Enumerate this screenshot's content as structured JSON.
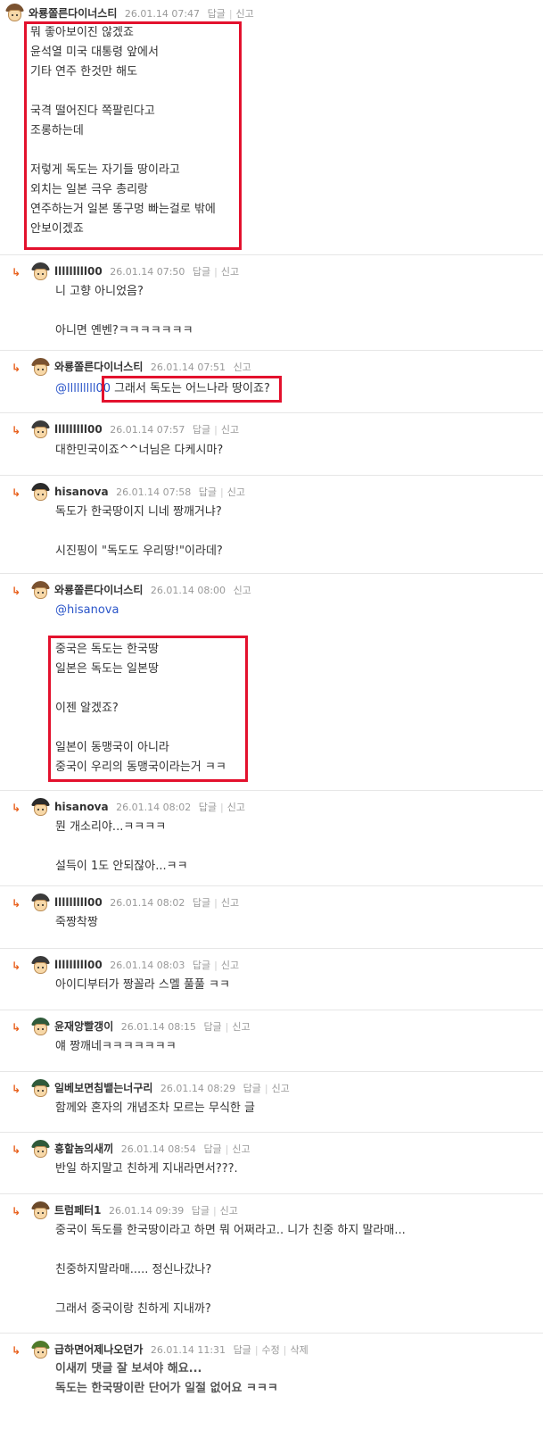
{
  "labels": {
    "reply": "답글",
    "report": "신고",
    "edit": "수정",
    "delete": "삭제",
    "reply_arrow": "↳"
  },
  "comments": [
    {
      "nick": "와룡쫄른다이너스티",
      "date": "26.01.14 07:47",
      "lines": [
        "뭐 좋아보이진 않겠죠",
        "윤석열 미국 대통령 앞에서",
        "기타 연주 한것만 해도",
        "",
        "국격 떨어진다 쪽팔린다고",
        "조롱하는데",
        "",
        "저렇게 독도는 자기들 땅이라고",
        "외치는 일본 극우 총리랑",
        "연주하는거 일본 똥구멍 빠는걸로 밖에",
        "안보이겠죠"
      ]
    },
    {
      "nick": "lllllllll00",
      "date": "26.01.14 07:50",
      "lines": [
        "니 고향 아니었음?",
        "",
        "아니면 옌벤?ㅋㅋㅋㅋㅋㅋㅋ"
      ]
    },
    {
      "nick": "와룡쫄른다이너스티",
      "date": "26.01.14 07:51",
      "mention": "@lllllllll00",
      "lines": [
        "그래서 독도는 어느나라 땅이죠?"
      ]
    },
    {
      "nick": "lllllllll00",
      "date": "26.01.14 07:57",
      "lines": [
        "대한민국이죠^^너님은 다케시마?"
      ]
    },
    {
      "nick": "hisanova",
      "date": "26.01.14 07:58",
      "lines": [
        "독도가 한국땅이지 니네 짱깨거냐?",
        "",
        "시진핑이 \"독도도 우리땅!\"이라데?"
      ]
    },
    {
      "nick": "와룡쫄른다이너스티",
      "date": "26.01.14 08:00",
      "mention": "@hisanova",
      "lines": [
        "중국은 독도는 한국땅",
        "일본은 독도는 일본땅",
        "",
        "이젠 알겠죠?",
        "",
        "일본이 동맹국이 아니라",
        "중국이 우리의 동맹국이라는거 ㅋㅋ"
      ]
    },
    {
      "nick": "hisanova",
      "date": "26.01.14 08:02",
      "lines": [
        "뭔 개소리야...ㅋㅋㅋㅋ",
        "",
        "설득이 1도 안되잖아...ㅋㅋ"
      ]
    },
    {
      "nick": "lllllllll00",
      "date": "26.01.14 08:02",
      "lines": [
        "죽짱착짱"
      ]
    },
    {
      "nick": "lllllllll00",
      "date": "26.01.14 08:03",
      "lines": [
        "아이디부터가 짱꼴라 스멜 풀풀 ㅋㅋ"
      ]
    },
    {
      "nick": "윤재앙빨갱이",
      "date": "26.01.14 08:15",
      "lines": [
        "얘 짱깨네ㅋㅋㅋㅋㅋㅋㅋ"
      ]
    },
    {
      "nick": "일베보면침뱉는너구리",
      "date": "26.01.14 08:29",
      "lines": [
        "함께와 혼자의 개념조차 모르는 무식한 글"
      ]
    },
    {
      "nick": "흥할놈의새끼",
      "date": "26.01.14 08:54",
      "lines": [
        "반일 하지말고 친하게 지내라면서???."
      ]
    },
    {
      "nick": "트럼페터1",
      "date": "26.01.14 09:39",
      "lines": [
        "중국이 독도를 한국땅이라고 하면 뭐 어쩌라고.. 니가 친중 하지 말라매...",
        "",
        "친중하지말라매..... 정신나갔나?",
        "",
        "그래서 중국이랑 친하게 지내까?"
      ]
    },
    {
      "nick": "급하면어제나오던가",
      "date": "26.01.14 11:31",
      "lines": [
        "이새끼 댓글 잘 보셔야 해요...",
        "독도는 한국땅이란 단어가 일절 없어요 ㅋㅋㅋ"
      ]
    }
  ],
  "colors": {
    "highlight": "#e3112d",
    "mention": "#2a55c9",
    "reply_arrow": "#e8601c"
  }
}
